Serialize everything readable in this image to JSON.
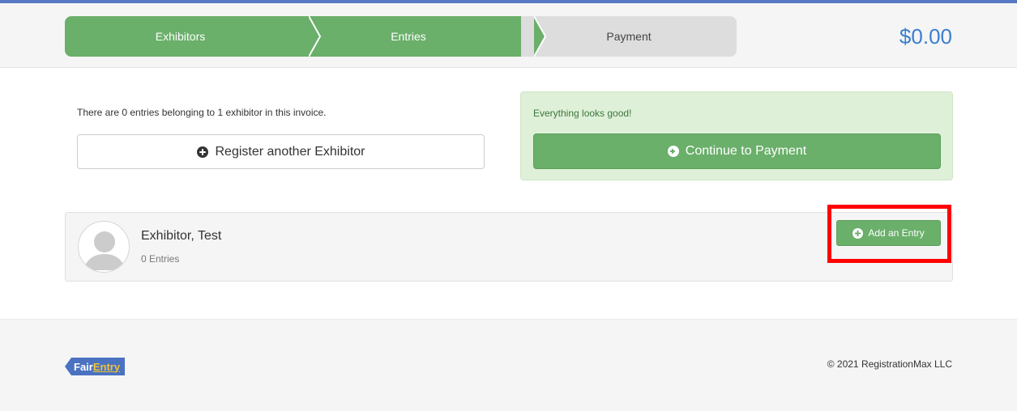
{
  "steps": [
    {
      "label": "Exhibitors",
      "state": "complete"
    },
    {
      "label": "Entries",
      "state": "complete"
    },
    {
      "label": "Payment",
      "state": "pending"
    }
  ],
  "total": "$0.00",
  "summary": {
    "text": "There are 0 entries belonging to 1 exhibitor in this invoice.",
    "register_button": "Register another Exhibitor"
  },
  "status_panel": {
    "message": "Everything looks good!",
    "continue_button": "Continue to Payment"
  },
  "exhibitor": {
    "name": "Exhibitor, Test",
    "entries": "0 Entries",
    "add_button": "Add an Entry"
  },
  "footer": {
    "logo_part1": "Fair",
    "logo_part2": "Entry",
    "copyright": "© 2021 RegistrationMax LLC"
  },
  "colors": {
    "accent_green": "#6aaf6a",
    "accent_blue": "#3a7fd0",
    "highlight_red": "#ff0000"
  },
  "icons": {
    "register": "plus-circle-icon",
    "continue": "arrow-circle-right-icon",
    "add_entry": "plus-circle-icon",
    "avatar": "user-placeholder-icon"
  }
}
